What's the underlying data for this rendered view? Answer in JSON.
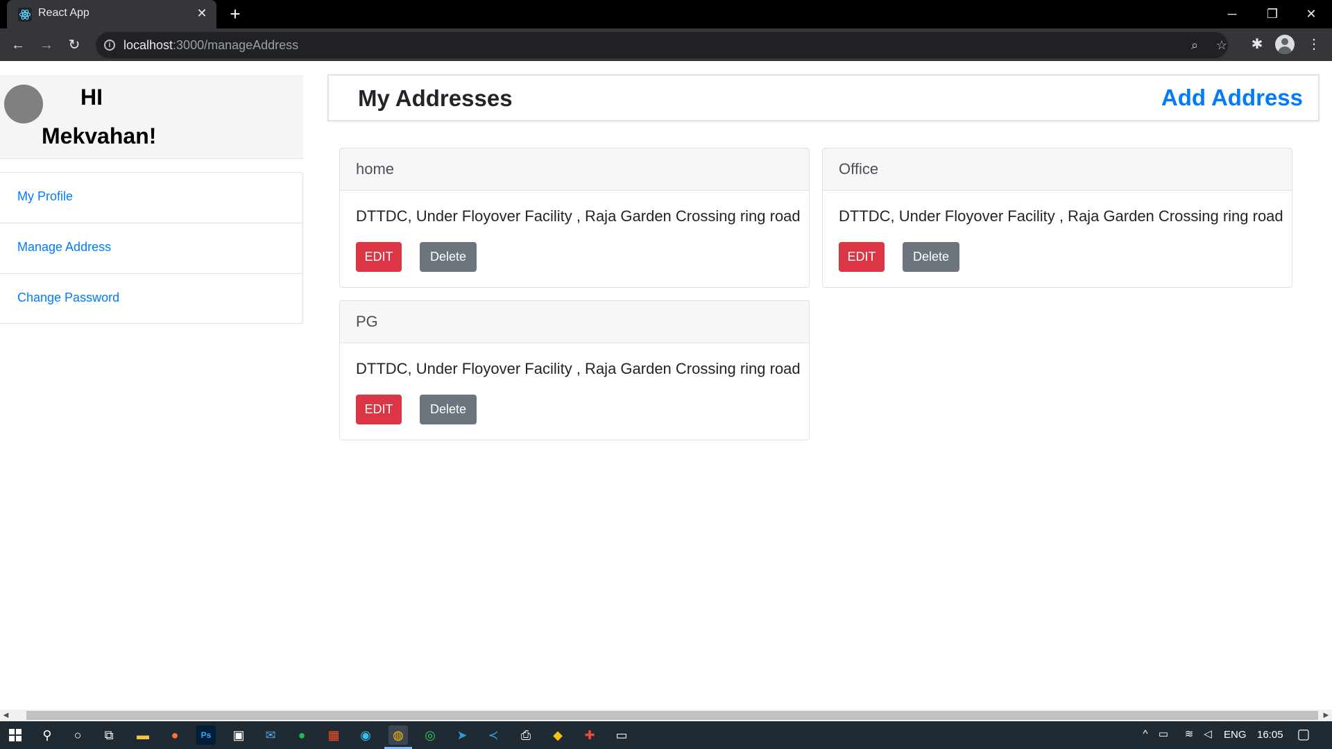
{
  "browser": {
    "tab_title": "React App",
    "url_host": "localhost",
    "url_path": ":3000/manageAddress"
  },
  "sidebar": {
    "greeting": "HI",
    "username": "Mekvahan!",
    "items": [
      {
        "label": "My Profile"
      },
      {
        "label": "Manage Address"
      },
      {
        "label": "Change Password"
      }
    ]
  },
  "main": {
    "title": "My Addresses",
    "add_label": "Add Address",
    "edit_label": "EDIT",
    "delete_label": "Delete",
    "addresses": [
      {
        "name": "home",
        "address": "DTTDC, Under Floyover Facility , Raja Garden Crossing ring road"
      },
      {
        "name": "Office",
        "address": "DTTDC, Under Floyover Facility , Raja Garden Crossing ring road"
      },
      {
        "name": "PG",
        "address": "DTTDC, Under Floyover Facility , Raja Garden Crossing ring road"
      }
    ]
  },
  "taskbar": {
    "language": "ENG",
    "time": "16:05"
  },
  "colors": {
    "link": "#007bff",
    "edit_button": "#dc3545",
    "delete_button": "#6c757d"
  }
}
